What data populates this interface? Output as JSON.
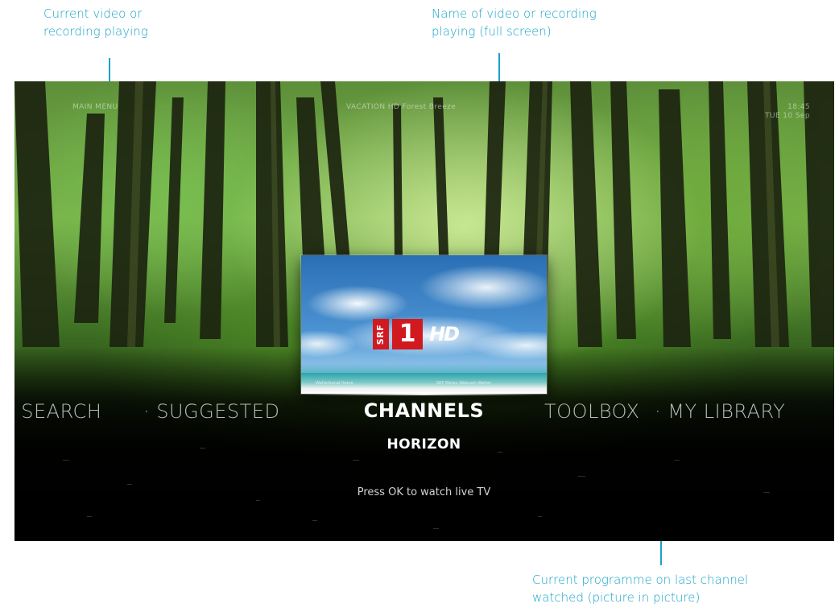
{
  "annotations": {
    "current_video": "Current video or\nrecording playing",
    "video_name": "Name of video or recording\nplaying (full screen)",
    "pip_programme": "Current programme on last channel\nwatched (picture in picture)"
  },
  "screen": {
    "top_bar": {
      "section": "MAIN MENU",
      "now_playing": "VACATION HD  Forest Breeze",
      "clock_line1": "18:45",
      "clock_line2": "TUE 10 Sep"
    },
    "pip": {
      "channel_logo": {
        "srf": "SRF",
        "number": "1",
        "hd": "HD"
      },
      "ticker_left": "Wetterkanal Home",
      "ticker_right": "SRF Meteo Webcam Wetter"
    },
    "menu": {
      "items_left": [
        "· SEARCH",
        "· SUGGESTED"
      ],
      "selected": "CHANNELS",
      "items_right": [
        "TOOLBOX",
        "· MY LIBRARY"
      ],
      "submenu": "HORIZON",
      "hint": "Press OK to watch live TV"
    }
  },
  "colors": {
    "annotation": "#1aa3c9",
    "channel_red": "#d01a20"
  }
}
